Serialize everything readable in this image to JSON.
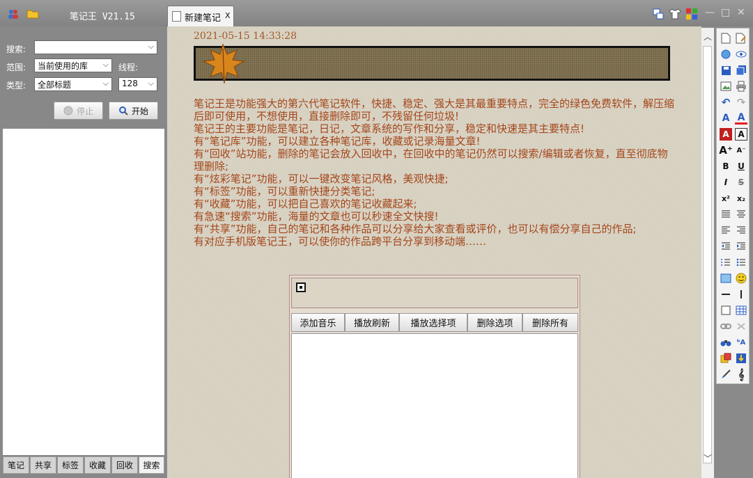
{
  "window": {
    "app_title": "笔记王 V21.15",
    "tab_label": "新建笔记",
    "tab_close": "X",
    "minimize": "—",
    "maximize": "□",
    "close": "✕"
  },
  "search_panel": {
    "search_label": "搜索:",
    "search_value": "",
    "scope_label": "范围:",
    "scope_value": "当前使用的库",
    "threads_label": "线程:",
    "type_label": "类型:",
    "type_value": "全部标题",
    "threads_value": "128",
    "stop_label": "停止",
    "start_label": "开始"
  },
  "bottom_tabs": [
    "笔记",
    "共享",
    "标签",
    "收藏",
    "回收",
    "搜索"
  ],
  "note": {
    "date": "2021-05-15 14:33:28",
    "paragraphs": [
      "笔记王是功能强大的第六代笔记软件，快捷、稳定、强大是其最重要特点，完全的绿色免费软件，解压缩后即可使用，不想使用，直接删除即可，不残留任何垃圾!",
      "笔记王的主要功能是笔记，日记，文章系统的写作和分享，稳定和快速是其主要特点!",
      "有“笔记库”功能，可以建立各种笔记库，收藏或记录海量文章!",
      "有“回收”站功能，删除的笔记会放入回收中，在回收中的笔记仍然可以搜索/编辑或者恢复，直至彻底物理删除;",
      "有“炫彩笔记”功能，可以一键改变笔记风格，美观快捷;",
      "有“标签”功能，可以重新快捷分类笔记;",
      "有“收藏”功能，可以把自己喜欢的笔记收藏起来;",
      "有急速“搜索”功能，海量的文章也可以秒速全文快搜!",
      "有“共享”功能，自己的笔记和各种作品可以分享给大家查看或评价，也可以有偿分享自己的作品;",
      "有对应手机版笔记王，可以使你的作品跨平台分享到移动端……"
    ]
  },
  "music": {
    "buttons": [
      "添加音乐",
      "播放刷新",
      "播放选择项",
      "删除选项",
      "删除所有"
    ]
  },
  "colors": {
    "note_text": "#a4461a",
    "date_text": "#a35a2a",
    "editor_bg": "#d9d3c4",
    "panel_bg": "#888888"
  }
}
